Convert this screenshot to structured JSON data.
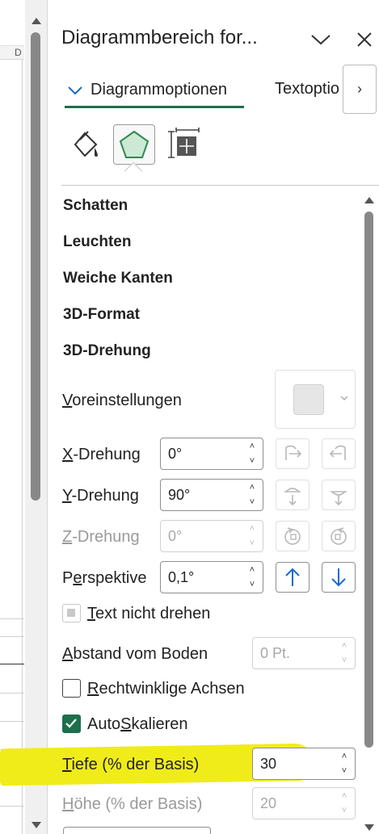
{
  "sheet": {
    "column_letter": "D"
  },
  "pane": {
    "title": "Diagrammbereich for...",
    "collapse_icon": "chevron-down-icon",
    "close_icon": "close-icon"
  },
  "tabs": [
    {
      "label": "Diagrammoptionen",
      "active": true
    },
    {
      "label": "Textoptio",
      "active": false
    },
    {
      "label": "›"
    }
  ],
  "category_icons": [
    "fill-line-icon",
    "effects-pentagon-icon",
    "size-properties-icon"
  ],
  "sections": [
    "Schatten",
    "Leuchten",
    "Weiche Kanten",
    "3D-Format",
    "3D-Drehung"
  ],
  "rotation": {
    "presets_label": {
      "u": "V",
      "rest": "oreinstellungen"
    },
    "x": {
      "u": "X",
      "rest": "-Drehung",
      "value": "0°"
    },
    "y": {
      "u": "Y",
      "rest": "-Drehung",
      "value": "90°"
    },
    "z": {
      "u": "Z",
      "rest": "-Drehung",
      "value": "0°"
    },
    "perspective": {
      "pre": "P",
      "u": "e",
      "rest": "rspektive",
      "value": "0,1°"
    },
    "keep_text_flat": {
      "u": "T",
      "rest": "ext nicht drehen"
    },
    "distance": {
      "u": "A",
      "rest": "bstand vom Boden",
      "value": "0 Pt."
    },
    "right_angle": {
      "u": "R",
      "rest": "echtwinklige Achsen"
    },
    "autoscale": {
      "pre": "Auto",
      "u": "S",
      "rest": "kalieren"
    },
    "depth": {
      "u": "T",
      "rest": "iefe (% der Basis)",
      "value": "30"
    },
    "height": {
      "u": "H",
      "rest": "öhe (% der Basis)",
      "value": "20"
    }
  },
  "colors": {
    "accent": "#1e6f4c",
    "highlight": "#f0ec1a",
    "blue_arrow": "#1a6ac8"
  }
}
